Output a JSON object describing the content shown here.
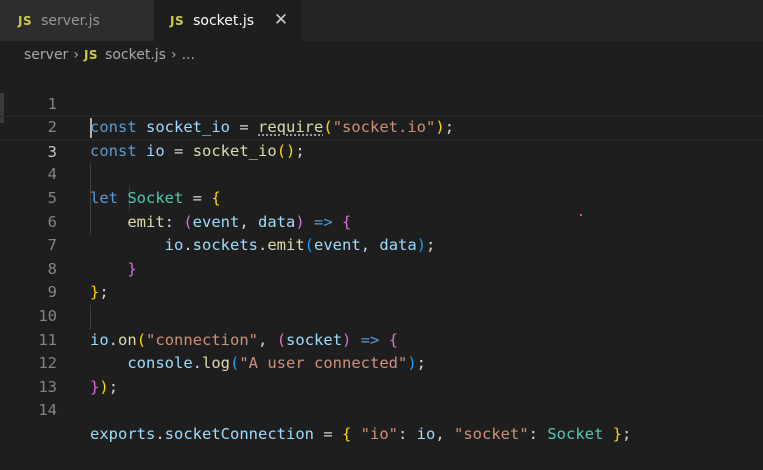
{
  "tabs": [
    {
      "badge": "JS",
      "label": "server.js"
    },
    {
      "badge": "JS",
      "label": "socket.js",
      "close": "✕"
    }
  ],
  "breadcrumb": {
    "folder": "server",
    "sep": "›",
    "badge": "JS",
    "file": "socket.js",
    "more": "..."
  },
  "line_numbers": [
    "1",
    "2",
    "3",
    "4",
    "5",
    "6",
    "7",
    "8",
    "9",
    "10",
    "11",
    "12",
    "13",
    "14"
  ],
  "active_line": "3",
  "code_lines": [
    "const socket_io = require(\"socket.io\");",
    "const io = socket_io();",
    "",
    "let Socket = {",
    "    emit: (event, data) => {",
    "        io.sockets.emit(event, data);",
    "    }",
    "};",
    "",
    "io.on(\"connection\", (socket) => {",
    "    console.log(\"A user connected\");",
    "});",
    "",
    "exports.socketConnection = { \"io\": io, \"socket\": Socket };"
  ],
  "colors": {
    "keyword": "#569cd6",
    "variable": "#9cdcfe",
    "function": "#dcdcaa",
    "string": "#ce9178",
    "bracket_gold": "#ffd700",
    "bracket_orchid": "#da70d6",
    "bracket_blue": "#179fff",
    "type": "#4ec9b0"
  }
}
